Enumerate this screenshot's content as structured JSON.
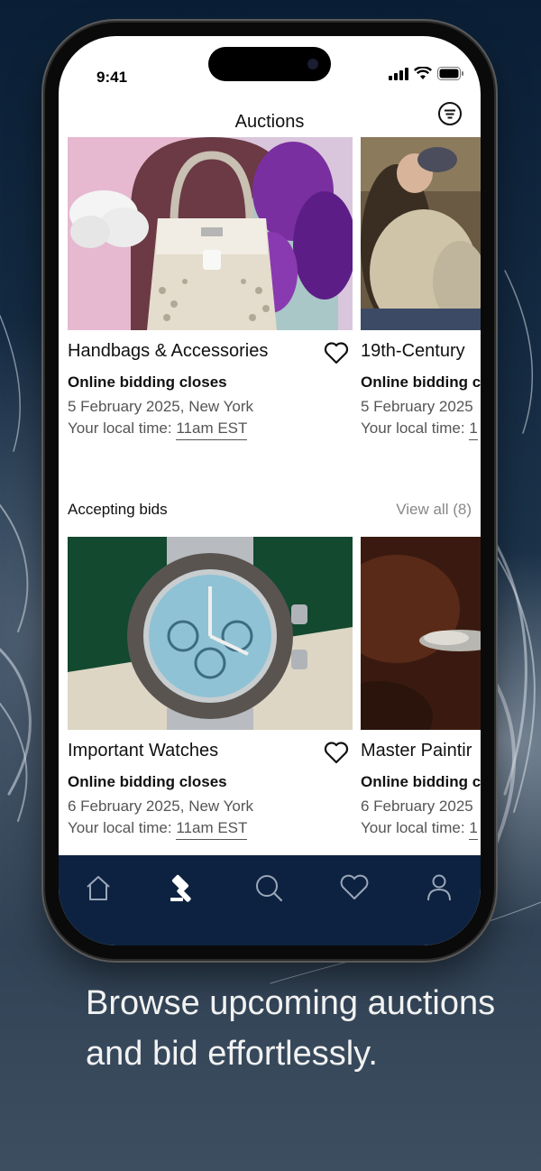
{
  "status_bar": {
    "time": "9:41"
  },
  "header": {
    "title": "Auctions",
    "filter_icon": "filter-icon"
  },
  "featured": [
    {
      "title": "Handbags & Accessories",
      "closes_label": "Online bidding closes",
      "date_location": "5 February 2025, New York",
      "local_time_label": "Your local time:",
      "local_time_value": "11am EST"
    },
    {
      "title": "19th-Century",
      "closes_label": "Online bidding c",
      "date_location": "5 February 2025",
      "local_time_label": "Your local time:",
      "local_time_value": "1"
    }
  ],
  "accepting": {
    "section_title": "Accepting bids",
    "view_all": "View all (8)",
    "items": [
      {
        "title": "Important Watches",
        "closes_label": "Online bidding closes",
        "date_location": "6 February 2025, New York",
        "local_time_label": "Your local time:",
        "local_time_value": "11am EST"
      },
      {
        "title": "Master Paintir",
        "closes_label": "Online bidding c",
        "date_location": "6 February 2025",
        "local_time_label": "Your local time:",
        "local_time_value": "1"
      }
    ]
  },
  "tab_bar": {
    "tabs": [
      "home-icon",
      "gavel-icon",
      "search-icon",
      "heart-icon",
      "profile-icon"
    ],
    "active": "gavel-icon"
  },
  "caption": "Browse upcoming auctions and bid effortlessly.",
  "colors": {
    "tab_bar_bg": "#0d2240",
    "background": "#0c2238"
  }
}
